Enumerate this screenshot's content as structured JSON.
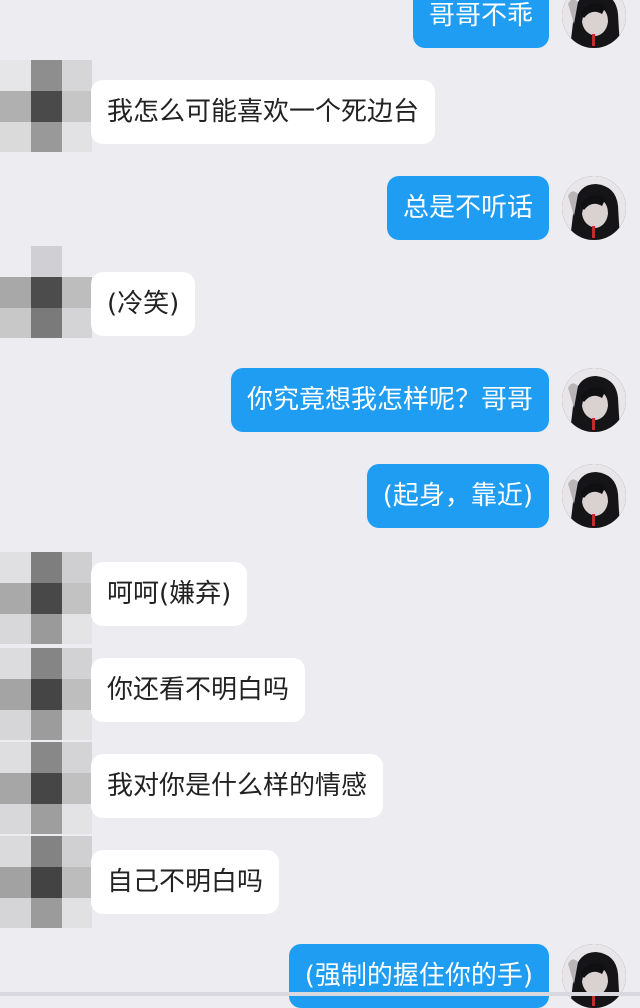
{
  "chat": {
    "messages": [
      {
        "side": "me",
        "text": "哥哥不乖"
      },
      {
        "side": "other",
        "text": "我怎么可能喜欢一个死边台"
      },
      {
        "side": "me",
        "text": "总是不听话"
      },
      {
        "side": "other",
        "text": "(冷笑)"
      },
      {
        "side": "me",
        "text": "你究竟想我怎样呢？哥哥"
      },
      {
        "side": "me",
        "text": "(起身，靠近)"
      },
      {
        "side": "other",
        "text": "呵呵(嫌弃)"
      },
      {
        "side": "other",
        "text": "你还看不明白吗"
      },
      {
        "side": "other",
        "text": "我对你是什么样的情感"
      },
      {
        "side": "other",
        "text": "自己不明白吗"
      },
      {
        "side": "me",
        "text": "(强制的握住你的手)"
      }
    ]
  },
  "colors": {
    "background": "#ececf1",
    "my_bubble": "#1e9df2",
    "other_bubble": "#ffffff"
  },
  "icons": {
    "my_avatar": "anime-avatar-icon",
    "other_avatar": "pixelated-avatar-icon"
  }
}
